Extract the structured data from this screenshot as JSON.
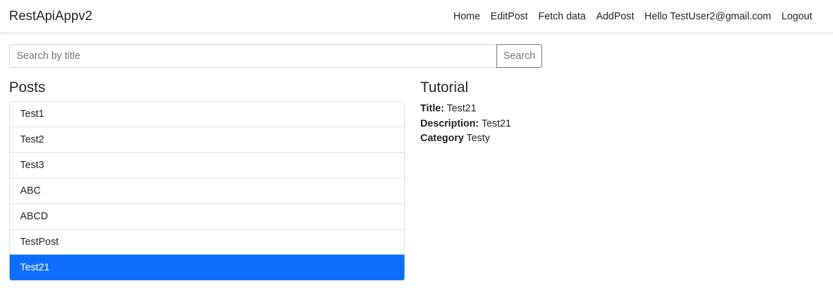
{
  "navbar": {
    "brand": "RestApiAppv2",
    "links": [
      "Home",
      "EditPost",
      "Fetch data",
      "AddPost",
      "Hello TestUser2@gmail.com",
      "Logout"
    ]
  },
  "search": {
    "value": "",
    "placeholder": "Search by title",
    "button_label": "Search"
  },
  "posts": {
    "title": "Posts",
    "items": [
      "Test1",
      "Test2",
      "Test3",
      "ABC",
      "ABCD",
      "TestPost",
      "Test21"
    ],
    "active_index": 6
  },
  "tutorial": {
    "title": "Tutorial",
    "fields": [
      {
        "label": "Title:",
        "value": "Test21"
      },
      {
        "label": "Description:",
        "value": "Test21"
      },
      {
        "label": "Category",
        "value": "Testy"
      }
    ]
  },
  "colors": {
    "accent": "#0d6efd",
    "border": "#dee2e6",
    "muted": "#6c757d"
  }
}
